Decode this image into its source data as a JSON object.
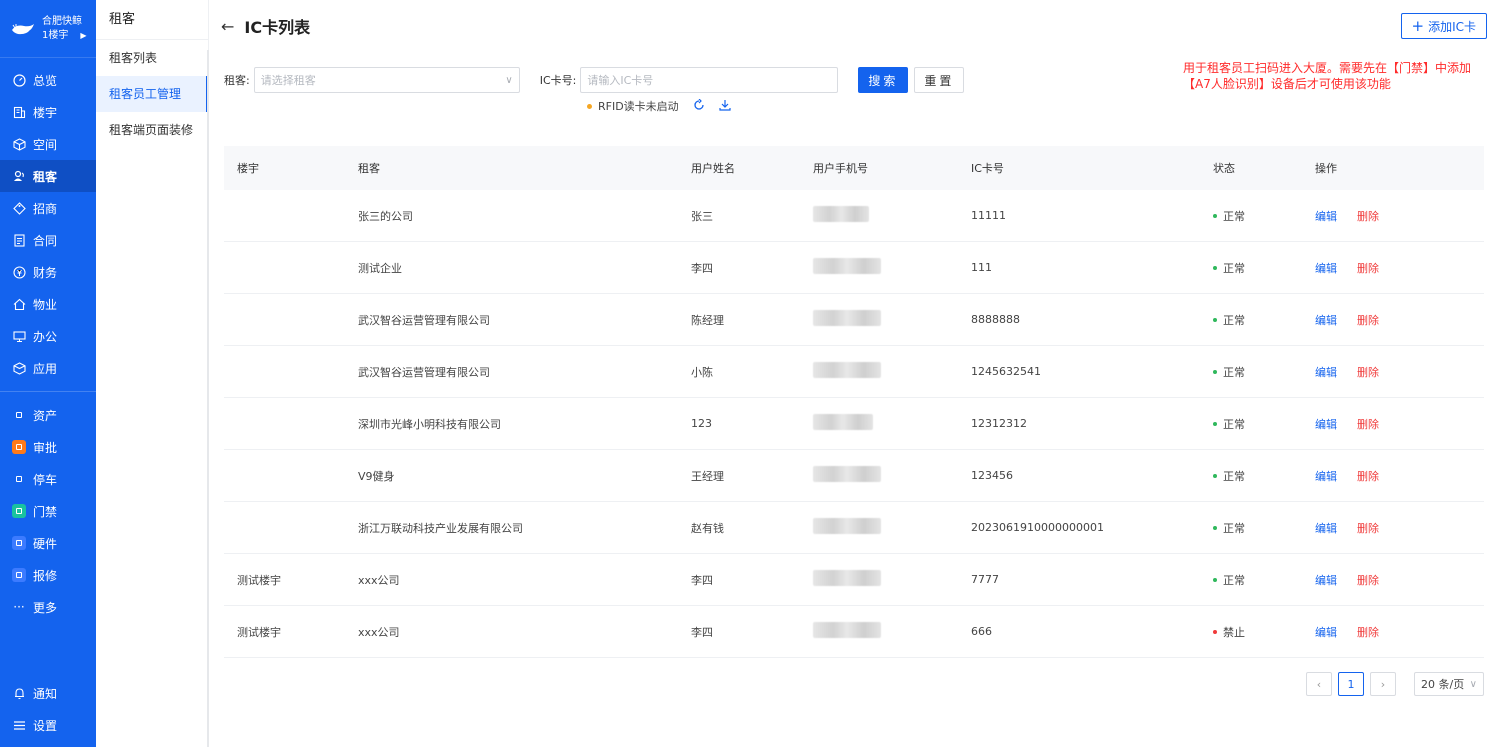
{
  "brand": {
    "name": "合肥快鲸",
    "building": "1楼宇"
  },
  "nav": {
    "items": [
      {
        "label": "总览",
        "icon": "dashboard-icon"
      },
      {
        "label": "楼宇",
        "icon": "building-icon"
      },
      {
        "label": "空间",
        "icon": "cube-icon"
      },
      {
        "label": "租客",
        "icon": "tenant-icon",
        "active": true
      },
      {
        "label": "招商",
        "icon": "tag-icon"
      },
      {
        "label": "合同",
        "icon": "document-icon"
      },
      {
        "label": "财务",
        "icon": "finance-icon"
      },
      {
        "label": "物业",
        "icon": "home-icon"
      },
      {
        "label": "办公",
        "icon": "monitor-icon"
      },
      {
        "label": "应用",
        "icon": "apps-icon"
      }
    ],
    "apps": [
      {
        "label": "资产",
        "color": "#1463ee"
      },
      {
        "label": "审批",
        "color": "#ff7a1a"
      },
      {
        "label": "停车",
        "color": "#1463ee"
      },
      {
        "label": "门禁",
        "color": "#19c2a0"
      },
      {
        "label": "硬件",
        "color": "#3c7bff"
      },
      {
        "label": "报修",
        "color": "#3c7bff"
      }
    ],
    "more": "更多",
    "bottom": [
      {
        "label": "通知",
        "icon": "bell-icon"
      },
      {
        "label": "设置",
        "icon": "menu-icon"
      }
    ]
  },
  "submenu": {
    "title": "租客",
    "items": [
      {
        "label": "租客列表"
      },
      {
        "label": "租客员工管理",
        "active": true
      },
      {
        "label": "租客端页面装修"
      }
    ]
  },
  "header": {
    "title": "IC卡列表",
    "add_label": "添加IC卡"
  },
  "notice": "用于租客员工扫码进入大厦。需要先在【门禁】中添加【A7人脸识别】设备后才可使用该功能",
  "filters": {
    "tenant_label": "租客:",
    "tenant_placeholder": "请选择租客",
    "card_label": "IC卡号:",
    "card_placeholder": "请输入IC卡号",
    "search_label": "搜索",
    "reset_label": "重置"
  },
  "rfid": {
    "status": "RFID读卡未启动"
  },
  "table": {
    "columns": [
      "楼宇",
      "租客",
      "用户姓名",
      "用户手机号",
      "IC卡号",
      "状态",
      "操作"
    ],
    "edit_label": "编辑",
    "delete_label": "删除",
    "rows": [
      {
        "building": "",
        "tenant": "张三的公司",
        "name": "张三",
        "card": "11111",
        "status": "正常",
        "ok": true
      },
      {
        "building": "",
        "tenant": "测试企业",
        "name": "李四",
        "card": "111",
        "status": "正常",
        "ok": true
      },
      {
        "building": "",
        "tenant": "武汉智谷运营管理有限公司",
        "name": "陈经理",
        "card": "8888888",
        "status": "正常",
        "ok": true
      },
      {
        "building": "",
        "tenant": "武汉智谷运营管理有限公司",
        "name": "小陈",
        "card": "1245632541",
        "status": "正常",
        "ok": true
      },
      {
        "building": "",
        "tenant": "深圳市光峰小明科技有限公司",
        "name": "123",
        "card": "12312312",
        "status": "正常",
        "ok": true
      },
      {
        "building": "",
        "tenant": "V9健身",
        "name": "王经理",
        "card": "123456",
        "status": "正常",
        "ok": true
      },
      {
        "building": "",
        "tenant": "浙江万联动科技产业发展有限公司",
        "name": "赵有钱",
        "card": "2023061910000000001",
        "status": "正常",
        "ok": true
      },
      {
        "building": "测试楼宇",
        "tenant": "xxx公司",
        "name": "李四",
        "card": "7777",
        "status": "正常",
        "ok": true
      },
      {
        "building": "测试楼宇",
        "tenant": "xxx公司",
        "name": "李四",
        "card": "666",
        "status": "禁止",
        "ok": false
      }
    ]
  },
  "pagination": {
    "current": "1",
    "page_size": "20 条/页"
  }
}
